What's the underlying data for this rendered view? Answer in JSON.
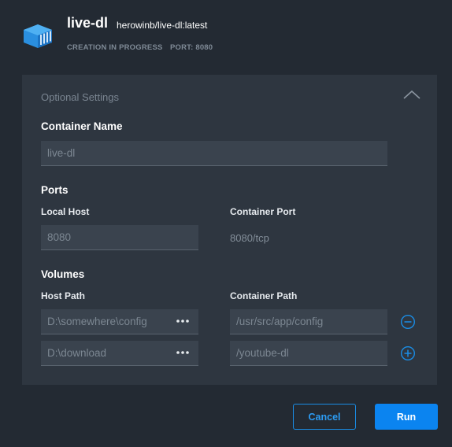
{
  "header": {
    "title": "live-dl",
    "image": "herowinb/live-dl:latest",
    "status": "CREATION IN PROGRESS",
    "port": "PORT: 8080",
    "icon": "container-icon"
  },
  "panel": {
    "optional_label": "Optional Settings",
    "collapse_icon": "chevron-up-icon",
    "container_name": {
      "title": "Container Name",
      "placeholder": "live-dl"
    },
    "ports": {
      "title": "Ports",
      "local_host_label": "Local Host",
      "container_port_label": "Container Port",
      "local_host_placeholder": "8080",
      "container_port_value": "8080/tcp"
    },
    "volumes": {
      "title": "Volumes",
      "host_path_label": "Host Path",
      "container_path_label": "Container Path",
      "rows": [
        {
          "host_placeholder": "D:\\somewhere\\config",
          "container_placeholder": "/usr/src/app/config",
          "action_icon": "remove-circle-icon"
        },
        {
          "host_placeholder": "D:\\download",
          "container_placeholder": "/youtube-dl",
          "action_icon": "add-circle-icon"
        }
      ]
    }
  },
  "footer": {
    "cancel_label": "Cancel",
    "run_label": "Run"
  },
  "colors": {
    "background": "#232a33",
    "panel": "#2e3640",
    "input": "#3a434e",
    "accent": "#0b84f0"
  }
}
